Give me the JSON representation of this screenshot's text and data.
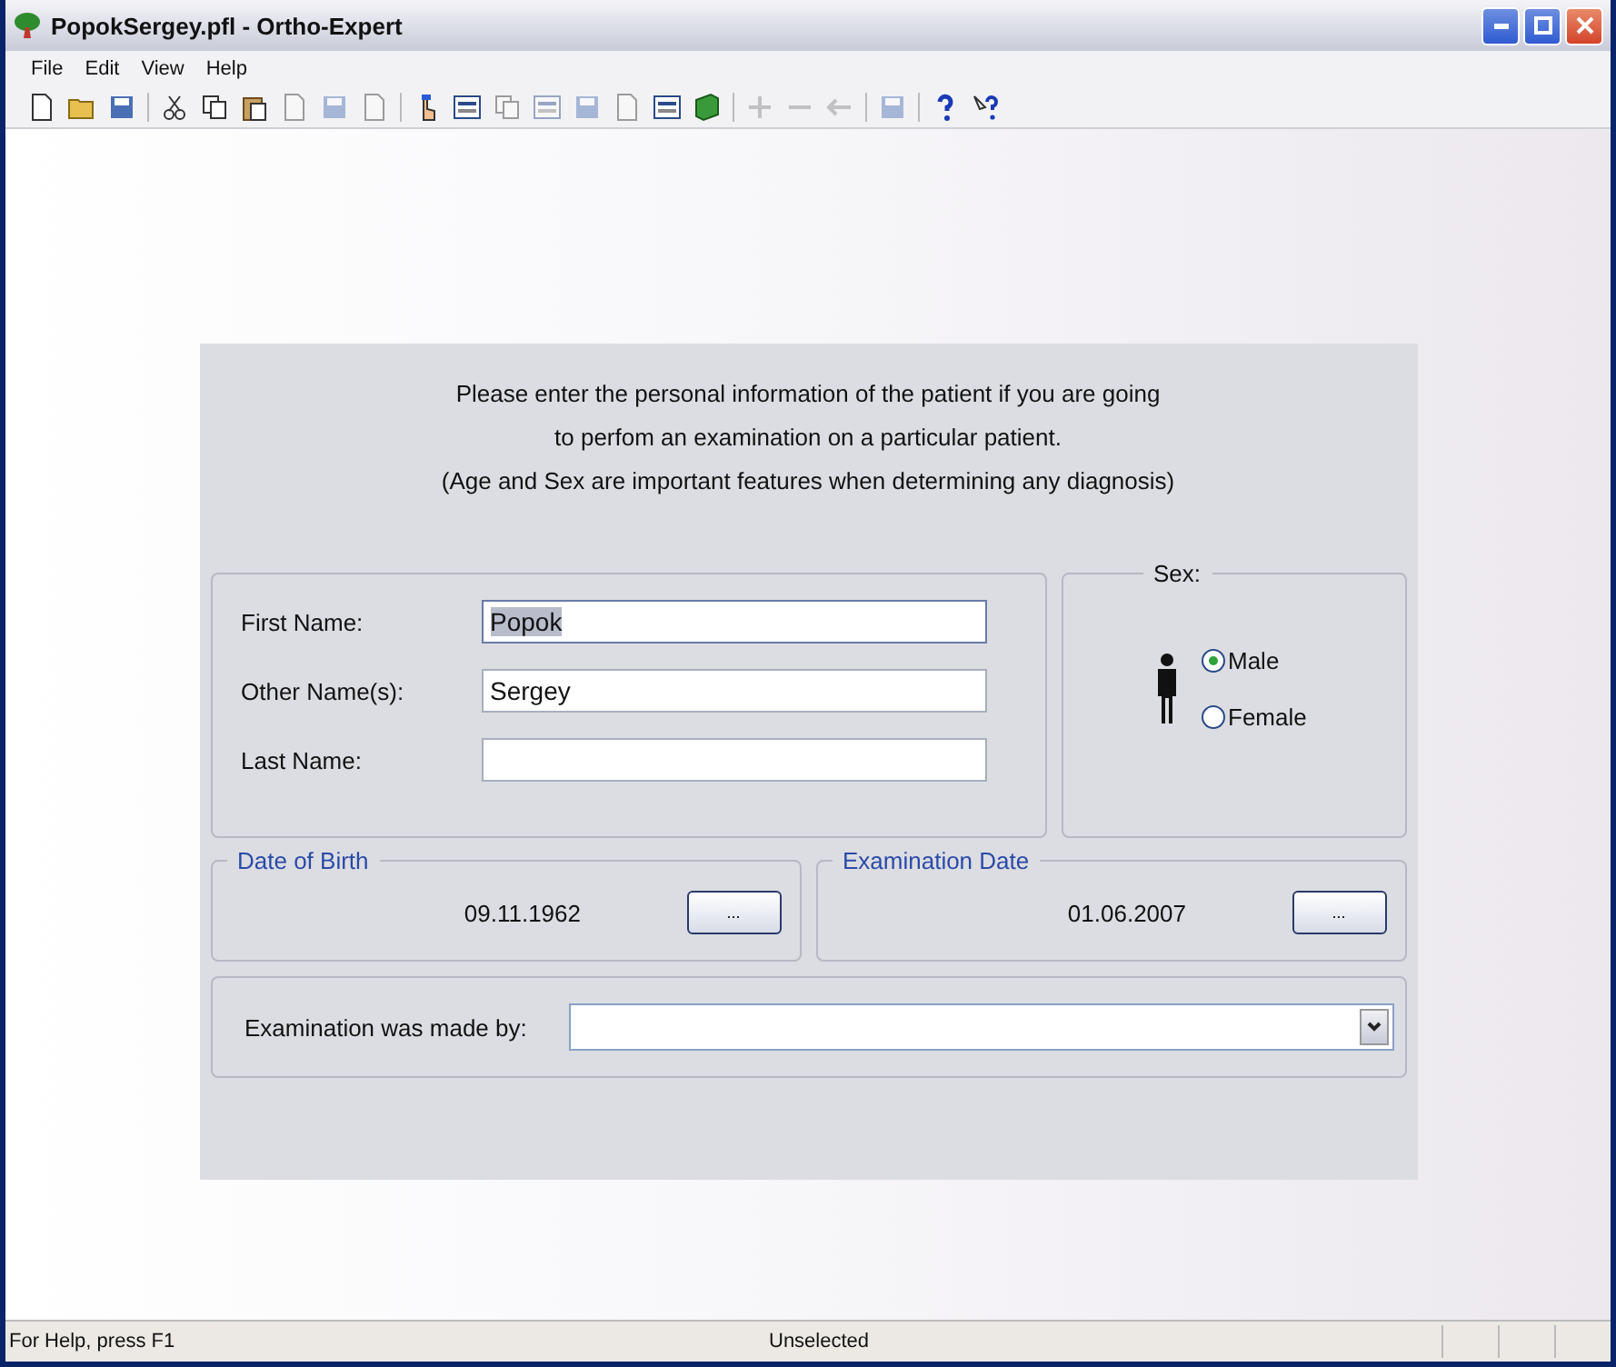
{
  "window": {
    "title": "PopokSergey.pfl - Ortho-Expert"
  },
  "menu": [
    {
      "label": "File"
    },
    {
      "label": "Edit"
    },
    {
      "label": "View"
    },
    {
      "label": "Help"
    }
  ],
  "intro": [
    "Please enter the personal information of the patient if you are going",
    "to perfom an examination on a particular patient.",
    "(Age and Sex are important features when determining any diagnosis)"
  ],
  "names": [
    {
      "label": "First Name:",
      "value": "Popok",
      "highlighted": true
    },
    {
      "label": "Other Name(s):",
      "value": "Sergey",
      "highlighted": false
    },
    {
      "label": "Last Name:",
      "highlighted": false
    }
  ],
  "sex": {
    "title": "Sex:",
    "options": [
      {
        "label": "Male",
        "selected": true
      },
      {
        "label": "Female",
        "selected": false
      }
    ]
  },
  "dates": [
    {
      "title": "Date of Birth",
      "value": "09.11.1962",
      "button": "..."
    },
    {
      "title": "Examination Date",
      "value": "01.06.2007",
      "button": "..."
    }
  ],
  "examiner": {
    "label": "Examination was made by:"
  },
  "status_bar": {
    "help": "For Help, press F1",
    "state": "Unselected"
  }
}
